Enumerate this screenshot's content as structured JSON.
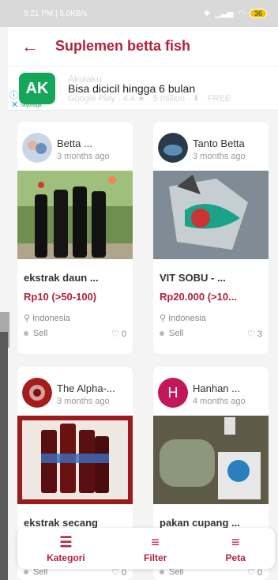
{
  "status_bar": {
    "time_speed": "9:21 PM | 5.0KB/s",
    "battery": "36"
  },
  "header": {
    "title": "Suplemen betta fish"
  },
  "ad": {
    "logo_text": "AK",
    "logo_sub": "Skybridge",
    "text": "Bisa dicicil hingga 6 bulan",
    "ghost_line1": "Akulaku",
    "ghost_line2": "Google Play · 4.4 ★ · 5 million · ⬇ · FREE",
    "info_icon": "i-circle-icon",
    "close_icon": "x-icon"
  },
  "cards": [
    {
      "seller_name": "Betta ...",
      "time": "3 months ago",
      "product_name": "ekstrak daun ...",
      "price": "Rp10  (>50-100)",
      "location": "Indonesia",
      "type": "Sell",
      "likes": "0"
    },
    {
      "seller_name": "Tanto Betta",
      "time": "3 months ago",
      "product_name": "VIT SOBU - ...",
      "price": "Rp20.000  (>10...",
      "location": "Indonesia",
      "type": "Sell",
      "likes": "3"
    },
    {
      "seller_name": "The Alpha-...",
      "time": "3 months ago",
      "product_name": "ekstrak secang",
      "type": "Sell",
      "likes": "0"
    },
    {
      "seller_name": "Hanhan ...",
      "avatar_letter": "H",
      "time": "4 months ago",
      "product_name": "pakan cupang ...",
      "type": "Sell",
      "likes": "0"
    }
  ],
  "bottom_nav": [
    {
      "label": "Kategori"
    },
    {
      "label": "Filter"
    },
    {
      "label": "Peta"
    }
  ],
  "colors": {
    "accent": "#b3213a"
  }
}
